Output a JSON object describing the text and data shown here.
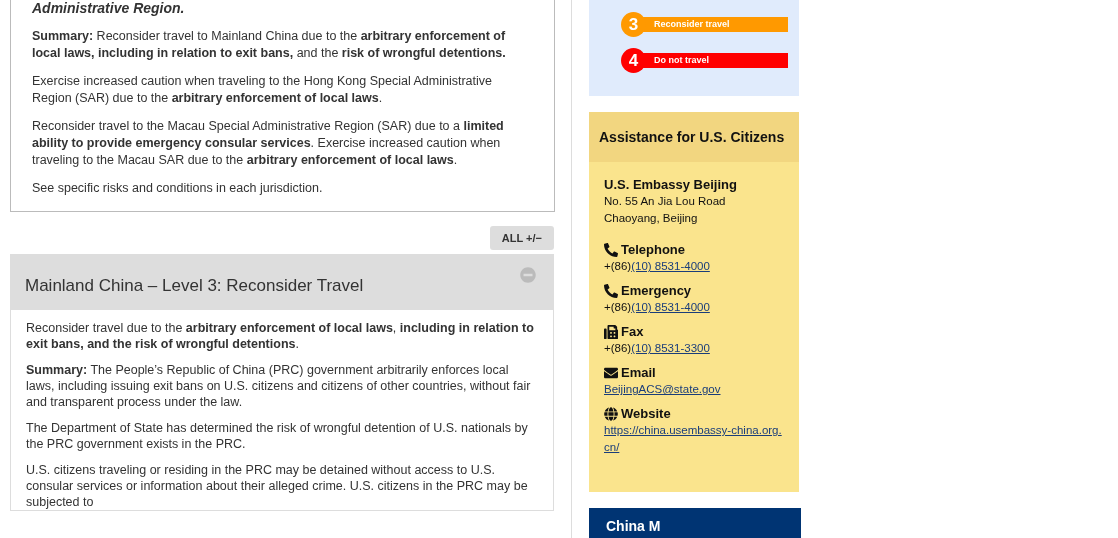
{
  "intro": {
    "lead": "Administrative Region.",
    "paragraphs": [
      "**Summary:** Reconsider travel to Mainland China due to the **arbitrary enforcement of local laws, including in relation to exit bans,** and the **risk of wrongful detentions.**",
      "Exercise increased caution when traveling to the Hong Kong Special Administrative Region (SAR) due to the **arbitrary enforcement of local laws**.",
      "Reconsider travel to the Macau Special Administrative Region (SAR) due to a **limited ability to provide emergency consular services**. Exercise increased caution when traveling to the Macau SAR due to the **arbitrary enforcement of local laws**.",
      "See specific risks and conditions in each jurisdiction."
    ]
  },
  "toggle_all": {
    "label": "ALL",
    "icon": "+/−"
  },
  "accordion": {
    "title": "Mainland China – Level 3: Reconsider Travel",
    "expanded": true,
    "paragraphs": [
      "Reconsider travel due to the **arbitrary enforcement of local laws**, **including in relation to exit bans, and the risk of wrongful detentions**.",
      "**Summary:** The People’s Republic of China (PRC) government arbitrarily enforces local laws, including issuing exit bans on U.S. citizens and citizens of other countries, without fair and transparent process under the law.",
      "The Department of State has determined the risk of wrongful detention of U.S. nationals by the PRC government exists in the PRC.",
      "U.S. citizens traveling or residing in the PRC may be detained without access to U.S. consular services or information about their alleged crime. U.S. citizens in the PRC may be subjected to"
    ]
  },
  "levels": [
    {
      "number": "3",
      "label": "Reconsider travel",
      "color": "#ff9900"
    },
    {
      "number": "4",
      "label": "Do not travel",
      "color": "#ff0000"
    }
  ],
  "assistance": {
    "title": "Assistance for U.S. Citizens",
    "office": "U.S. Embassy Beijing",
    "address": [
      "No. 55 An Jia Lou Road",
      "Chaoyang, Beijing"
    ],
    "contacts": [
      {
        "kind": "phone",
        "label": "Telephone",
        "prefix": "+(86)",
        "link": "(10) 8531-4000"
      },
      {
        "kind": "phone",
        "label": "Emergency",
        "prefix": "+(86)",
        "link": "(10) 8531-4000"
      },
      {
        "kind": "fax",
        "label": "Fax",
        "prefix": "+(86)",
        "link": "(10) 8531-3300"
      },
      {
        "kind": "email",
        "label": "Email",
        "link": "BeijingACS@state.gov"
      },
      {
        "kind": "web",
        "label": "Website",
        "link": "https://china.usembassy-china.org.cn/"
      }
    ]
  },
  "map_card": {
    "title": "China M"
  }
}
